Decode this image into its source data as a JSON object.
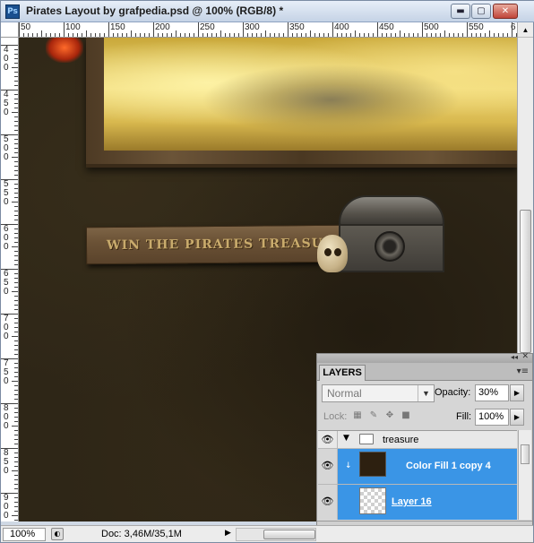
{
  "window": {
    "app_icon": "Ps",
    "title": "Pirates Layout by grafpedia.psd @ 100% (RGB/8) *",
    "minimize_glyph": "▬",
    "maximize_glyph": "▢",
    "close_glyph": "✕"
  },
  "rulers": {
    "top_labels": [
      "50",
      "100",
      "150",
      "200",
      "250",
      "300",
      "350",
      "400",
      "450",
      "500",
      "550",
      "6"
    ],
    "left_labels": [
      [
        "4",
        "0",
        "0"
      ],
      [
        "4",
        "5",
        "0"
      ],
      [
        "5",
        "0",
        "0"
      ],
      [
        "5",
        "5",
        "0"
      ],
      [
        "6",
        "0",
        "0"
      ],
      [
        "6",
        "5",
        "0"
      ],
      [
        "7",
        "0",
        "0"
      ],
      [
        "7",
        "5",
        "0"
      ],
      [
        "8",
        "0",
        "0"
      ],
      [
        "8",
        "5",
        "0"
      ],
      [
        "9",
        "0",
        "0"
      ]
    ]
  },
  "canvas": {
    "banner_text": "WIN THE PIRATES TREASURE"
  },
  "layers_panel": {
    "tab_label": "LAYERS",
    "collapse_glyph": "◂◂",
    "close_glyph": "✕",
    "menu_glyph": "▾≡",
    "blend_mode": "Normal",
    "opacity_label": "Opacity:",
    "opacity_value": "30%",
    "lock_label": "Lock:",
    "fill_label": "Fill:",
    "fill_value": "100%",
    "layers": [
      {
        "name": "treasure",
        "type": "group",
        "visible": true,
        "selected": false
      },
      {
        "name": "Color Fill 1 copy 4",
        "type": "fill",
        "visible": true,
        "selected": true
      },
      {
        "name": "Layer 16",
        "type": "pixel",
        "visible": true,
        "selected": true
      }
    ],
    "footer_icons": [
      "link-icon",
      "fx-icon",
      "mask-icon",
      "adjustment-icon",
      "group-icon",
      "new-layer-icon",
      "trash-icon"
    ]
  },
  "status_bar": {
    "zoom": "100%",
    "doc_info": "Doc: 3,46M/35,1M"
  }
}
